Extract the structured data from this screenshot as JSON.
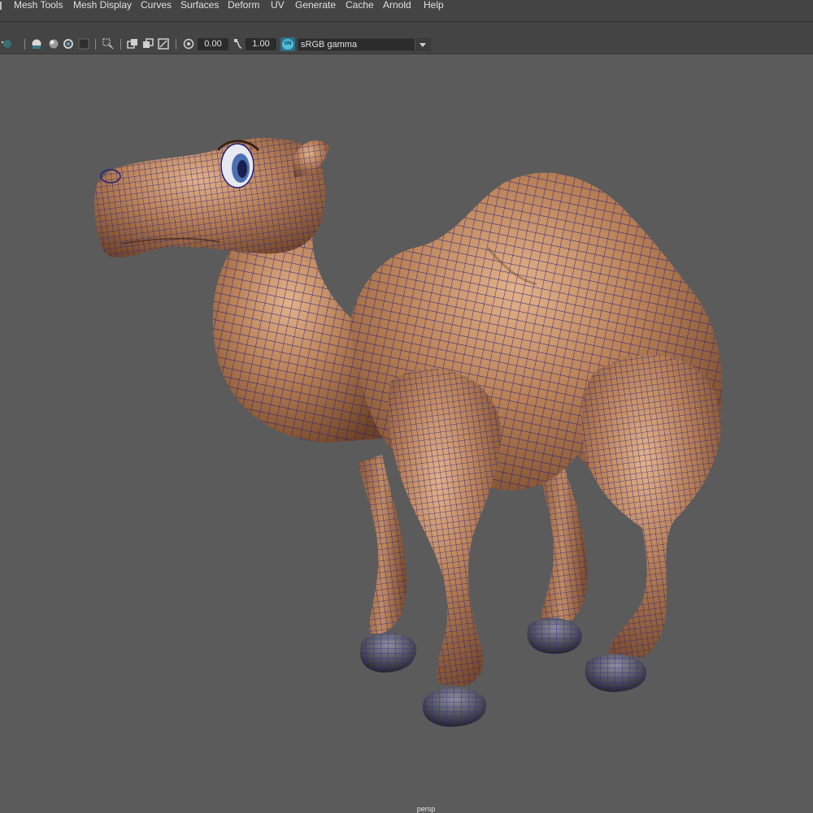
{
  "menubar": {
    "items": [
      {
        "label": "Mesh Tools"
      },
      {
        "label": "Mesh Display"
      },
      {
        "label": "Curves"
      },
      {
        "label": "Surfaces"
      },
      {
        "label": "Deform"
      },
      {
        "label": "UV"
      },
      {
        "label": "Generate"
      },
      {
        "label": "Cache"
      },
      {
        "label": "Arnold"
      },
      {
        "label": "Help"
      }
    ]
  },
  "toolbar": {
    "exposure_value": "0.00",
    "gamma_value": "1.00",
    "color_management_badge": "ON",
    "color_space": "sRGB gamma",
    "icons": [
      "shading-sphere-icon",
      "flat-shade-icon",
      "lighting-icon",
      "isolate-icon",
      "xray-icon",
      "wireframe-icon",
      "resolution-gate-icon",
      "film-gate-icon",
      "camera-icon",
      "exposure-icon",
      "gamma-icon",
      "color-management-icon",
      "dropdown-arrow-icon"
    ]
  },
  "viewport": {
    "camera_label": "persp",
    "background_color": "#5b5b5b",
    "model_color": "#b07a52",
    "wire_color": "#1c1f7a"
  }
}
